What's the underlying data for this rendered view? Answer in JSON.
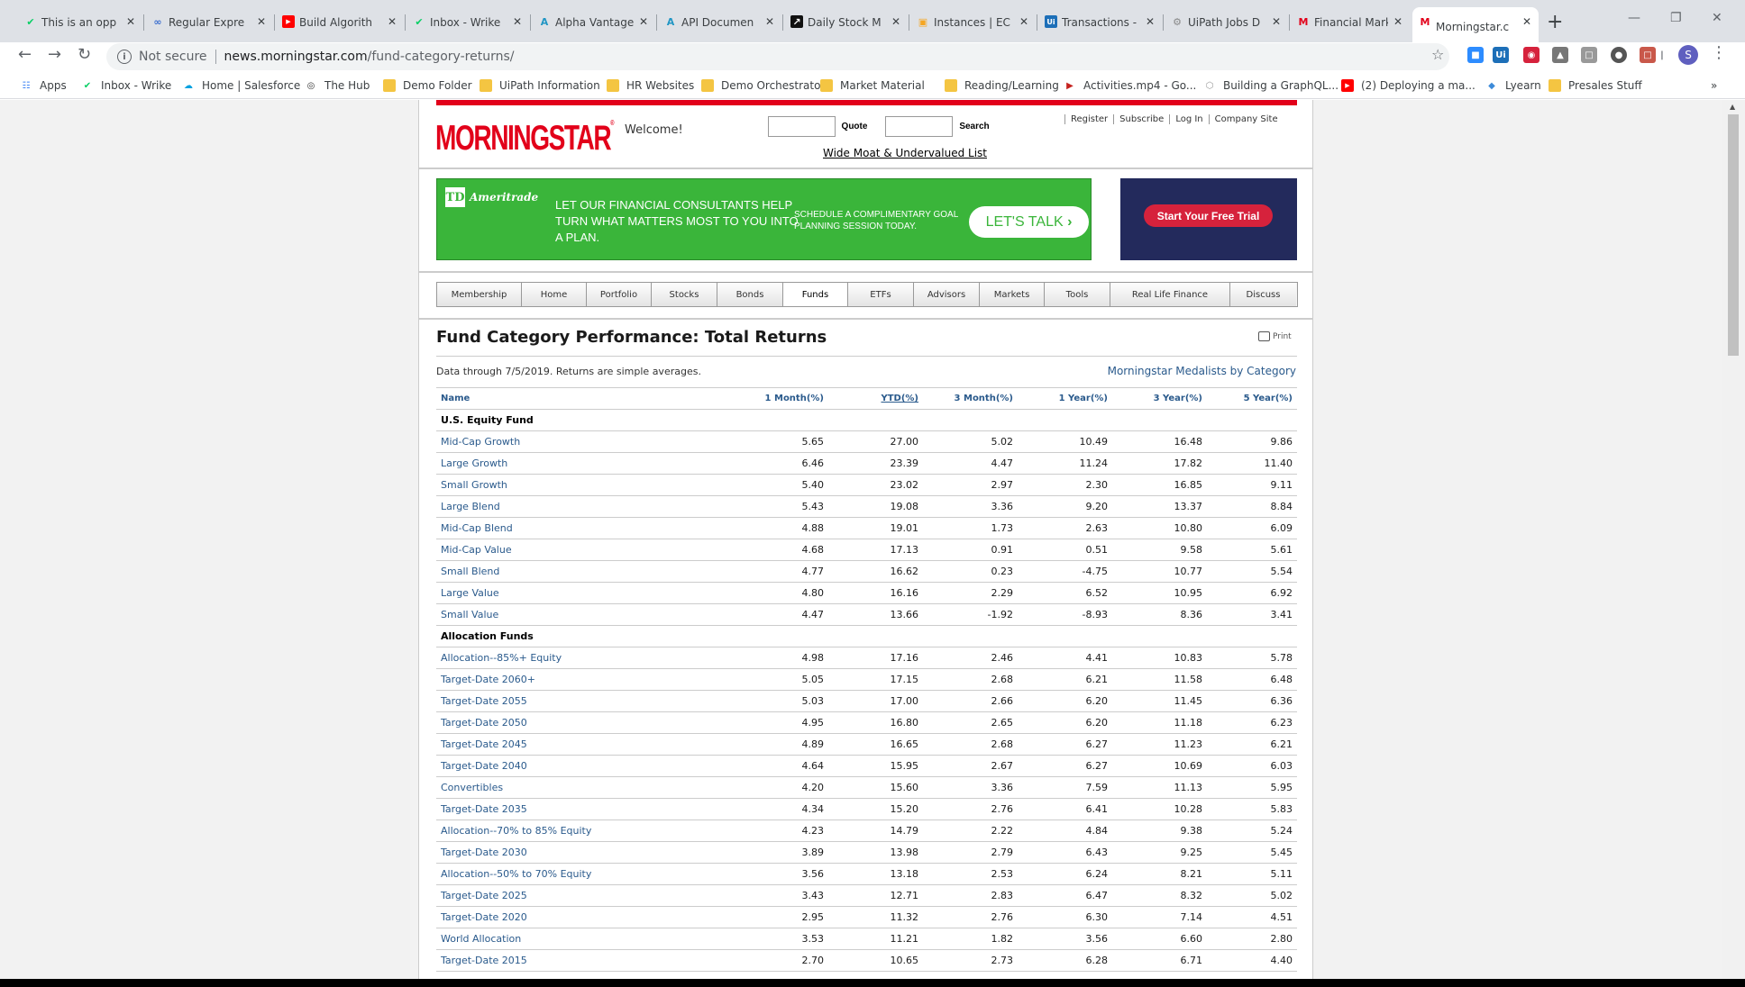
{
  "browser": {
    "tabs": [
      {
        "title": "This is an opp",
        "icon": "wrike-check-icon",
        "icon_color": "#08cf65"
      },
      {
        "title": "Regular Expre",
        "icon": "infinity-icon",
        "icon_color": "#3b6ecf"
      },
      {
        "title": "Build Algorith",
        "icon": "youtube-icon",
        "icon_color": "#ff0000"
      },
      {
        "title": "Inbox - Wrike",
        "icon": "wrike-check-icon",
        "icon_color": "#08cf65"
      },
      {
        "title": "Alpha Vantage",
        "icon": "alpha-vantage-icon",
        "icon_color": "#2196c4"
      },
      {
        "title": "API Documen",
        "icon": "alpha-vantage-icon",
        "icon_color": "#2196c4"
      },
      {
        "title": "Daily Stock M",
        "icon": "chart-icon",
        "icon_color": "#111111"
      },
      {
        "title": "Instances | EC",
        "icon": "aws-cube-icon",
        "icon_color": "#f5a623"
      },
      {
        "title": "Transactions -",
        "icon": "uipath-icon",
        "icon_color": "#1d6fb8"
      },
      {
        "title": "UiPath Jobs D",
        "icon": "gear-icon",
        "icon_color": "#888888"
      },
      {
        "title": "Financial Mark",
        "icon": "morningstar-icon",
        "icon_color": "#e2001a"
      },
      {
        "title": "Morningstar.c",
        "icon": "morningstar-icon",
        "icon_color": "#e2001a"
      }
    ],
    "address": {
      "security_label": "Not secure",
      "host": "news.morningstar.com",
      "path": "/fund-category-returns/"
    },
    "bookmarks": [
      {
        "label": "Apps",
        "icon": "apps-grid-icon"
      },
      {
        "label": "Inbox - Wrike",
        "icon": "wrike-check-icon"
      },
      {
        "label": "Home | Salesforce",
        "icon": "salesforce-cloud-icon"
      },
      {
        "label": "The Hub",
        "icon": "globe-icon"
      },
      {
        "label": "Demo Folder",
        "icon": "folder-icon"
      },
      {
        "label": "UiPath Information",
        "icon": "folder-icon"
      },
      {
        "label": "HR Websites",
        "icon": "folder-icon"
      },
      {
        "label": "Demo Orchestrator",
        "icon": "folder-icon"
      },
      {
        "label": "Market Material",
        "icon": "folder-icon"
      },
      {
        "label": "Reading/Learning",
        "icon": "folder-icon"
      },
      {
        "label": "Activities.mp4 - Go...",
        "icon": "video-file-icon"
      },
      {
        "label": "Building a GraphQL...",
        "icon": "graphql-icon"
      },
      {
        "label": "(2) Deploying a ma...",
        "icon": "youtube-icon"
      },
      {
        "label": "Lyearn",
        "icon": "lyearn-icon"
      },
      {
        "label": "Presales Stuff",
        "icon": "folder-icon"
      }
    ],
    "profile_initial": "S"
  },
  "header": {
    "logo": "MORNINGSTAR",
    "logo_reg": "®",
    "welcome": "Welcome!",
    "quote_btn": "Quote",
    "search_btn": "Search",
    "links": [
      "Register",
      "Subscribe",
      "Log In",
      "Company Site"
    ],
    "moat_link": "Wide Moat & Undervalued List"
  },
  "ads": {
    "td_brand": "Ameritrade",
    "td_mark": "TD",
    "td_text": "LET OUR FINANCIAL CONSULTANTS HELP TURN WHAT MATTERS MOST TO YOU INTO A PLAN.",
    "td_schedule": "SCHEDULE A COMPLIMENTARY GOAL PLANNING SESSION TODAY.",
    "td_cta": "LET'S TALK",
    "trial_btn": "Start Your Free Trial"
  },
  "nav": {
    "items": [
      "Membership",
      "Home",
      "Portfolio",
      "Stocks",
      "Bonds",
      "Funds",
      "ETFs",
      "Advisors",
      "Markets",
      "Tools",
      "Real Life Finance",
      "Discuss"
    ],
    "active": "Funds"
  },
  "content": {
    "title": "Fund Category Performance: Total Returns",
    "print": "Print",
    "data_through": "Data through 7/5/2019. Returns are simple averages.",
    "medalists_link": "Morningstar Medalists by Category",
    "columns": [
      "Name",
      "1 Month(%)",
      "YTD(%)",
      "3 Month(%)",
      "1 Year(%)",
      "3 Year(%)",
      "5 Year(%)"
    ],
    "sorted_column": "YTD(%)",
    "groups": [
      {
        "name": "U.S. Equity Fund",
        "rows": [
          [
            "Mid-Cap Growth",
            "5.65",
            "27.00",
            "5.02",
            "10.49",
            "16.48",
            "9.86"
          ],
          [
            "Large Growth",
            "6.46",
            "23.39",
            "4.47",
            "11.24",
            "17.82",
            "11.40"
          ],
          [
            "Small Growth",
            "5.40",
            "23.02",
            "2.97",
            "2.30",
            "16.85",
            "9.11"
          ],
          [
            "Large Blend",
            "5.43",
            "19.08",
            "3.36",
            "9.20",
            "13.37",
            "8.84"
          ],
          [
            "Mid-Cap Blend",
            "4.88",
            "19.01",
            "1.73",
            "2.63",
            "10.80",
            "6.09"
          ],
          [
            "Mid-Cap Value",
            "4.68",
            "17.13",
            "0.91",
            "0.51",
            "9.58",
            "5.61"
          ],
          [
            "Small Blend",
            "4.77",
            "16.62",
            "0.23",
            "-4.75",
            "10.77",
            "5.54"
          ],
          [
            "Large Value",
            "4.80",
            "16.16",
            "2.29",
            "6.52",
            "10.95",
            "6.92"
          ],
          [
            "Small Value",
            "4.47",
            "13.66",
            "-1.92",
            "-8.93",
            "8.36",
            "3.41"
          ]
        ]
      },
      {
        "name": "Allocation Funds",
        "rows": [
          [
            "Allocation--85%+ Equity",
            "4.98",
            "17.16",
            "2.46",
            "4.41",
            "10.83",
            "5.78"
          ],
          [
            "Target-Date 2060+",
            "5.05",
            "17.15",
            "2.68",
            "6.21",
            "11.58",
            "6.48"
          ],
          [
            "Target-Date 2055",
            "5.03",
            "17.00",
            "2.66",
            "6.20",
            "11.45",
            "6.36"
          ],
          [
            "Target-Date 2050",
            "4.95",
            "16.80",
            "2.65",
            "6.20",
            "11.18",
            "6.23"
          ],
          [
            "Target-Date 2045",
            "4.89",
            "16.65",
            "2.68",
            "6.27",
            "11.23",
            "6.21"
          ],
          [
            "Target-Date 2040",
            "4.64",
            "15.95",
            "2.67",
            "6.27",
            "10.69",
            "6.03"
          ],
          [
            "Convertibles",
            "4.20",
            "15.60",
            "3.36",
            "7.59",
            "11.13",
            "5.95"
          ],
          [
            "Target-Date 2035",
            "4.34",
            "15.20",
            "2.76",
            "6.41",
            "10.28",
            "5.83"
          ],
          [
            "Allocation--70% to 85% Equity",
            "4.23",
            "14.79",
            "2.22",
            "4.84",
            "9.38",
            "5.24"
          ],
          [
            "Target-Date 2030",
            "3.89",
            "13.98",
            "2.79",
            "6.43",
            "9.25",
            "5.45"
          ],
          [
            "Allocation--50% to 70% Equity",
            "3.56",
            "13.18",
            "2.53",
            "6.24",
            "8.21",
            "5.11"
          ],
          [
            "Target-Date 2025",
            "3.43",
            "12.71",
            "2.83",
            "6.47",
            "8.32",
            "5.02"
          ],
          [
            "Target-Date 2020",
            "2.95",
            "11.32",
            "2.76",
            "6.30",
            "7.14",
            "4.51"
          ],
          [
            "World Allocation",
            "3.53",
            "11.21",
            "1.82",
            "3.56",
            "6.60",
            "2.80"
          ],
          [
            "Target-Date 2015",
            "2.70",
            "10.65",
            "2.73",
            "6.28",
            "6.71",
            "4.40"
          ]
        ]
      }
    ]
  }
}
